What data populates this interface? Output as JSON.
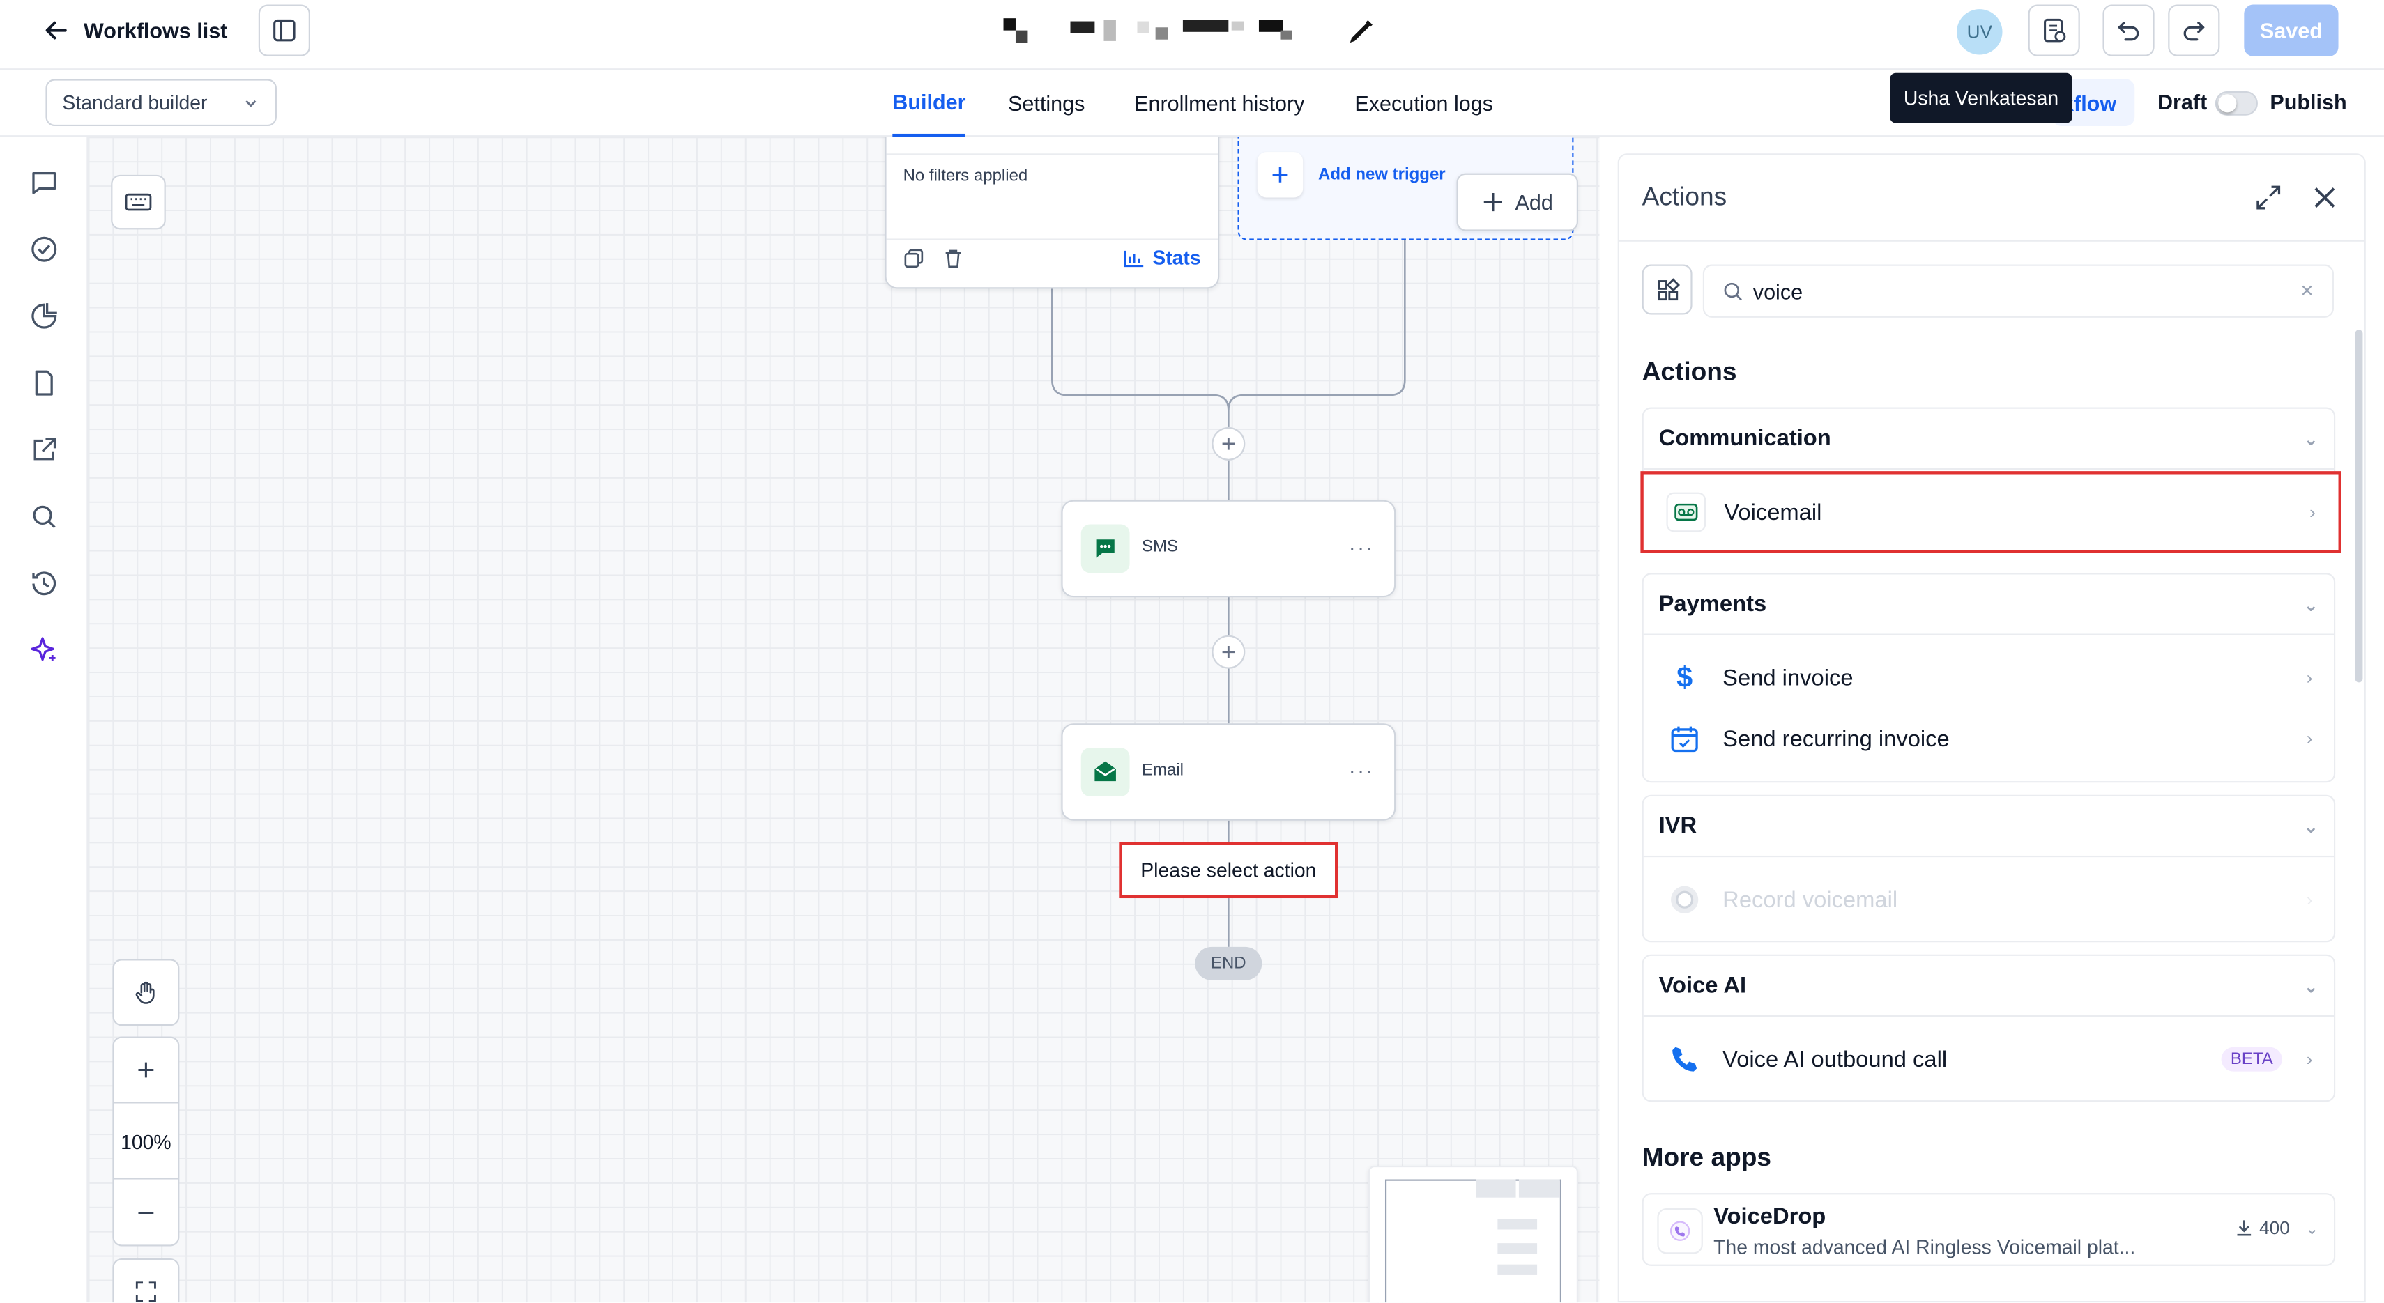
{
  "topbar": {
    "back_label": "Workflows list",
    "avatar_initials": "UV",
    "tooltip": "Usha Venkatesan",
    "saved_label": "Saved"
  },
  "subbar": {
    "builder_select": "Standard builder",
    "tabs": [
      "Builder",
      "Settings",
      "Enrollment history",
      "Execution logs"
    ],
    "active_tab": "Builder",
    "partial_link": "kflow",
    "draft_label": "Draft",
    "publish_label": "Publish"
  },
  "canvas": {
    "trigger_card": {
      "filters_text": "No filters applied",
      "stats_label": "Stats"
    },
    "add_trigger_label": "Add new trigger",
    "add_label": "Add",
    "nodes": [
      {
        "label": "SMS",
        "icon": "message-icon"
      },
      {
        "label": "Email",
        "icon": "mail-icon"
      }
    ],
    "select_action_label": "Please select action",
    "end_label": "END",
    "zoom_level": "100%"
  },
  "panel": {
    "title": "Actions",
    "search_value": "voice",
    "section_title": "Actions",
    "groups": [
      {
        "name": "Communication",
        "items": [
          {
            "label": "Voicemail",
            "icon": "voicemail-icon"
          }
        ]
      },
      {
        "name": "Payments",
        "items": [
          {
            "label": "Send invoice",
            "icon": "dollar-icon"
          },
          {
            "label": "Send recurring invoice",
            "icon": "calendar-icon"
          }
        ]
      },
      {
        "name": "IVR",
        "items": [
          {
            "label": "Record voicemail",
            "icon": "record-icon",
            "disabled": true
          }
        ]
      },
      {
        "name": "Voice AI",
        "items": [
          {
            "label": "Voice AI outbound call",
            "icon": "phone-icon",
            "badge": "BETA"
          }
        ]
      }
    ],
    "more_apps_title": "More apps",
    "apps": [
      {
        "name": "VoiceDrop",
        "description": "The most advanced AI Ringless Voicemail plat...",
        "downloads": "400"
      }
    ]
  },
  "colors": {
    "accent": "#155eef",
    "highlight": "#e03131",
    "node_green": "#067647"
  }
}
